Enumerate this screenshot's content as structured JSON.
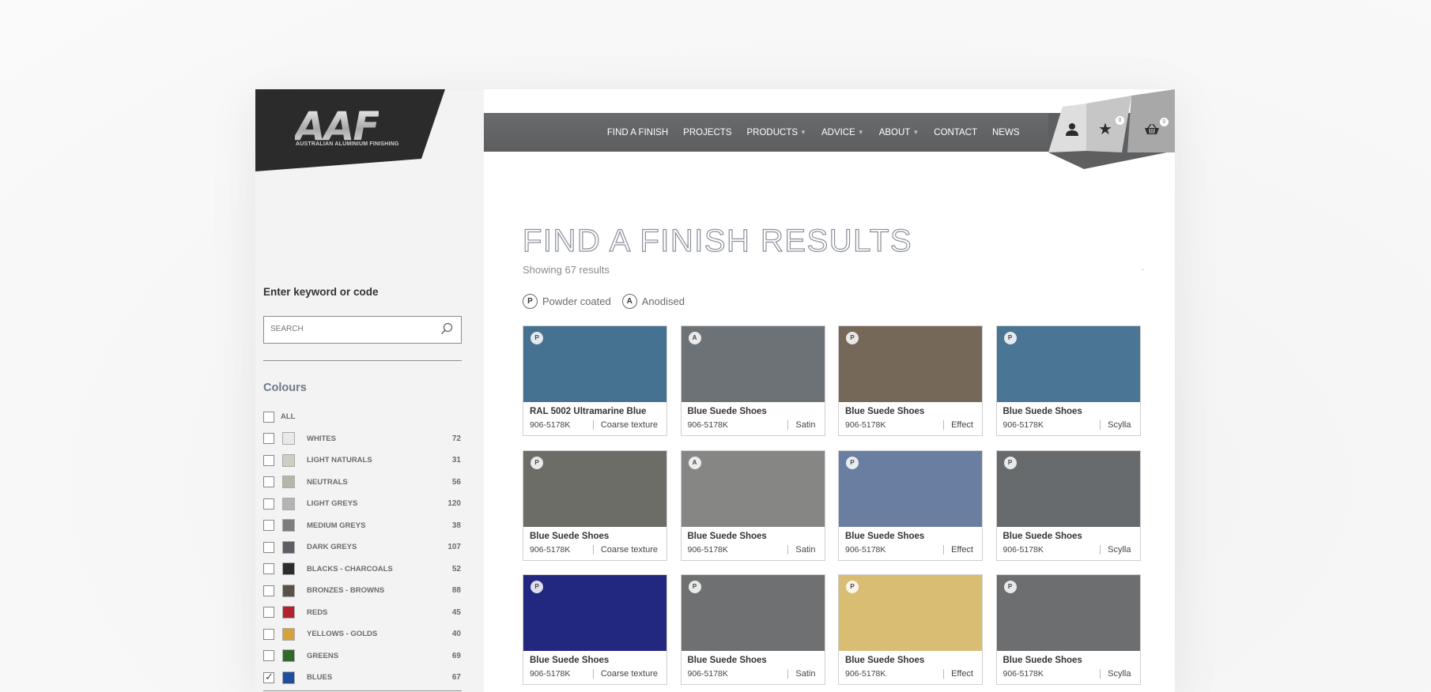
{
  "brand": {
    "mark": "AAF",
    "subtitle": "AUSTRALIAN ALUMINIUM FINISHING"
  },
  "nav": [
    {
      "label": "FIND A FINISH",
      "dropdown": false
    },
    {
      "label": "PROJECTS",
      "dropdown": false
    },
    {
      "label": "PRODUCTS",
      "dropdown": true
    },
    {
      "label": "ADVICE",
      "dropdown": true
    },
    {
      "label": "ABOUT",
      "dropdown": true
    },
    {
      "label": "CONTACT",
      "dropdown": false
    },
    {
      "label": "NEWS",
      "dropdown": false
    }
  ],
  "header_icons": {
    "favourites_count": "0",
    "cart_count": "0"
  },
  "sidebar": {
    "keyword_label": "Enter keyword or code",
    "search_placeholder": "SEARCH",
    "colours_title": "Colours",
    "colours": [
      {
        "name": "ALL",
        "count": "",
        "swatch": "",
        "checked": false
      },
      {
        "name": "WHITES",
        "count": "72",
        "swatch": "#e9e9e6",
        "checked": false
      },
      {
        "name": "LIGHT NATURALS",
        "count": "31",
        "swatch": "#cfcdc6",
        "checked": false
      },
      {
        "name": "NEUTRALS",
        "count": "56",
        "swatch": "#b7b4aa",
        "checked": false
      },
      {
        "name": "LIGHT GREYS",
        "count": "120",
        "swatch": "#b4b4b4",
        "checked": false
      },
      {
        "name": "MEDIUM GREYS",
        "count": "38",
        "swatch": "#7b7d7f",
        "checked": false
      },
      {
        "name": "DARK GREYS",
        "count": "107",
        "swatch": "#5c6064",
        "checked": false
      },
      {
        "name": "BLACKS - CHARCOALS",
        "count": "52",
        "swatch": "#2b2c2d",
        "checked": false
      },
      {
        "name": "BRONZES - BROWNS",
        "count": "88",
        "swatch": "#5a5248",
        "checked": false
      },
      {
        "name": "REDS",
        "count": "45",
        "swatch": "#b3222f",
        "checked": false
      },
      {
        "name": "YELLOWS - GOLDS",
        "count": "40",
        "swatch": "#d3a23c",
        "checked": false
      },
      {
        "name": "GREENS",
        "count": "69",
        "swatch": "#2f6a2c",
        "checked": false
      },
      {
        "name": "BLUES",
        "count": "67",
        "swatch": "#1d4d9b",
        "checked": true
      }
    ]
  },
  "main": {
    "title": "FIND A FINISH RESULTS",
    "showing": "Showing 67 results",
    "marker": ".",
    "legend": [
      {
        "badge": "P",
        "label": "Powder coated"
      },
      {
        "badge": "A",
        "label": "Anodised"
      }
    ],
    "results": [
      {
        "type": "P",
        "name": "RAL 5002 Ultramarine Blue",
        "code": "906-5178K",
        "finish": "Coarse texture",
        "color": "#467292"
      },
      {
        "type": "A",
        "name": "Blue Suede Shoes",
        "code": "906-5178K",
        "finish": "Satin",
        "color": "#6d7276"
      },
      {
        "type": "P",
        "name": "Blue Suede Shoes",
        "code": "906-5178K",
        "finish": "Effect",
        "color": "#766858"
      },
      {
        "type": "P",
        "name": "Blue Suede Shoes",
        "code": "906-5178K",
        "finish": "Scylla",
        "color": "#4a7595"
      },
      {
        "type": "P",
        "name": "Blue Suede Shoes",
        "code": "906-5178K",
        "finish": "Coarse texture",
        "color": "#6c6d67"
      },
      {
        "type": "A",
        "name": "Blue Suede Shoes",
        "code": "906-5178K",
        "finish": "Satin",
        "color": "#868784"
      },
      {
        "type": "P",
        "name": "Blue Suede Shoes",
        "code": "906-5178K",
        "finish": "Effect",
        "color": "#6a7ea2"
      },
      {
        "type": "P",
        "name": "Blue Suede Shoes",
        "code": "906-5178K",
        "finish": "Scylla",
        "color": "#676b6e"
      },
      {
        "type": "P",
        "name": "Blue Suede Shoes",
        "code": "906-5178K",
        "finish": "Coarse texture",
        "color": "#22277f"
      },
      {
        "type": "P",
        "name": "Blue Suede Shoes",
        "code": "906-5178K",
        "finish": "Satin",
        "color": "#6f7071"
      },
      {
        "type": "P",
        "name": "Blue Suede Shoes",
        "code": "906-5178K",
        "finish": "Effect",
        "color": "#d9bd72"
      },
      {
        "type": "P",
        "name": "Blue Suede Shoes",
        "code": "906-5178K",
        "finish": "Scylla",
        "color": "#6d6e6f"
      }
    ]
  }
}
